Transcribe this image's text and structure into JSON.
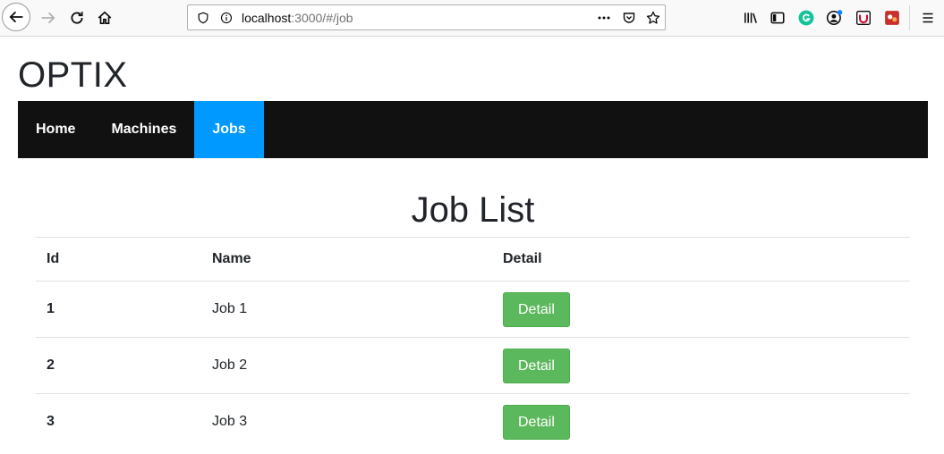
{
  "browser": {
    "url_host": "localhost",
    "url_rest": ":3000/#/job"
  },
  "page": {
    "brand": "OPTIX",
    "nav": [
      {
        "label": "Home",
        "active": false
      },
      {
        "label": "Machines",
        "active": false
      },
      {
        "label": "Jobs",
        "active": true
      }
    ],
    "title": "Job List"
  },
  "table": {
    "headers": [
      "Id",
      "Name",
      "Detail"
    ],
    "rows": [
      {
        "id": "1",
        "name": "Job 1",
        "action": "Detail"
      },
      {
        "id": "2",
        "name": "Job 2",
        "action": "Detail"
      },
      {
        "id": "3",
        "name": "Job 3",
        "action": "Detail"
      }
    ]
  },
  "colors": {
    "nav_bg": "#111111",
    "nav_active": "#0099ff",
    "detail_button": "#5cb85c"
  },
  "icons": [
    "back-icon",
    "forward-icon",
    "reload-icon",
    "home-icon",
    "shield-icon",
    "info-icon",
    "more-icon",
    "pocket-icon",
    "star-icon",
    "library-icon",
    "sidebar-icon",
    "grammarly-icon",
    "account-icon",
    "extension-icon",
    "extension2-icon",
    "menu-icon"
  ]
}
